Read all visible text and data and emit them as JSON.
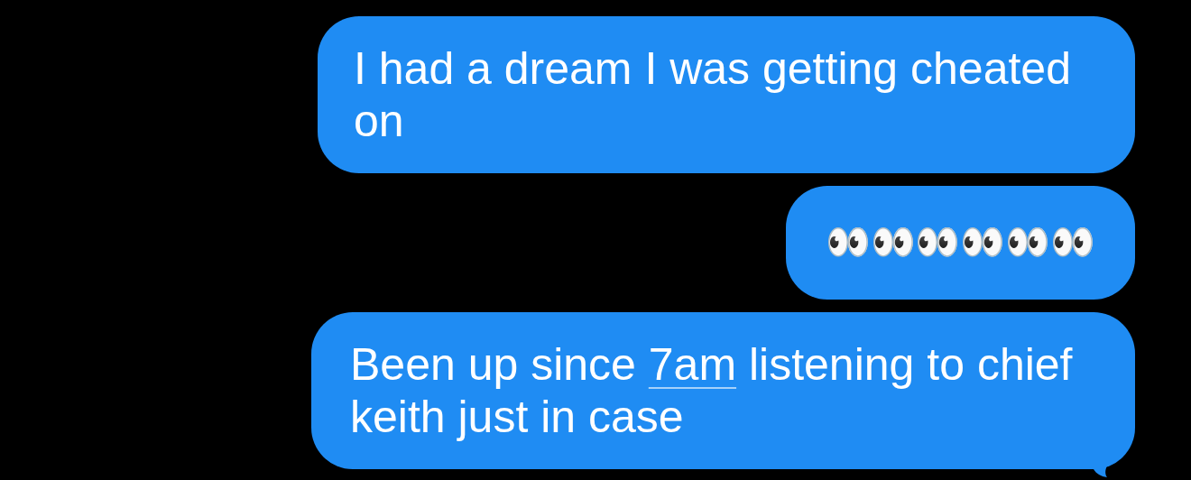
{
  "messages": [
    {
      "kind": "text",
      "tail": false,
      "parts": [
        {
          "text": "I had a dream I was getting cheated on",
          "link": false
        }
      ]
    },
    {
      "kind": "emoji",
      "tail": false,
      "text": "👀👀👀👀👀👀"
    },
    {
      "kind": "text",
      "tail": true,
      "parts": [
        {
          "text": "Been up since ",
          "link": false
        },
        {
          "text": "7am",
          "link": true
        },
        {
          "text": " listening to chief keith just in case",
          "link": false
        }
      ]
    }
  ]
}
